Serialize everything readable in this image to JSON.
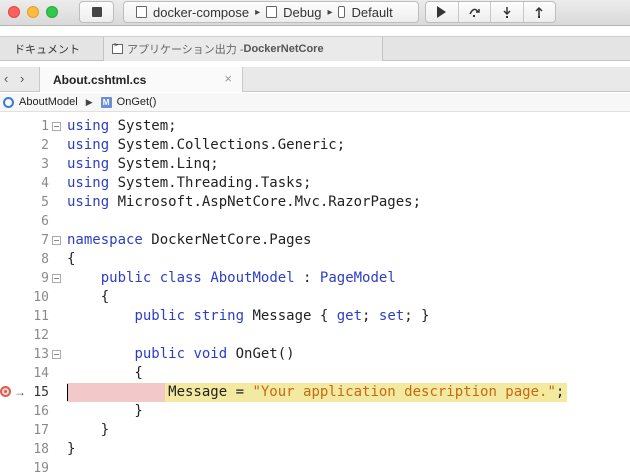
{
  "toolbar": {
    "project": "docker-compose",
    "configuration": "Debug",
    "device": "Default"
  },
  "pad_tabs": {
    "documents": "ドキュメント",
    "output_prefix": "アプリケーション出力 - ",
    "output_name": "DockerNetCore"
  },
  "editor": {
    "tab_title": "About.cshtml.cs",
    "close_symbol": "×",
    "nav_arrows": "‹ ›"
  },
  "pathbar": {
    "class_name": "AboutModel",
    "method_name": "OnGet()",
    "method_icon_letter": "M"
  },
  "code": {
    "breakpoint_line": 15,
    "lines": [
      {
        "n": "1",
        "fold": true,
        "t": [
          [
            "kw",
            "using"
          ],
          [
            "plain",
            " System;"
          ]
        ]
      },
      {
        "n": "2",
        "t": [
          [
            "kw",
            "using"
          ],
          [
            "plain",
            " System.Collections.Generic;"
          ]
        ]
      },
      {
        "n": "3",
        "t": [
          [
            "kw",
            "using"
          ],
          [
            "plain",
            " System.Linq;"
          ]
        ]
      },
      {
        "n": "4",
        "t": [
          [
            "kw",
            "using"
          ],
          [
            "plain",
            " System.Threading.Tasks;"
          ]
        ]
      },
      {
        "n": "5",
        "t": [
          [
            "kw",
            "using"
          ],
          [
            "plain",
            " Microsoft.AspNetCore.Mvc.RazorPages;"
          ]
        ]
      },
      {
        "n": "6",
        "t": []
      },
      {
        "n": "7",
        "fold": true,
        "t": [
          [
            "kw",
            "namespace"
          ],
          [
            "plain",
            " DockerNetCore.Pages"
          ]
        ]
      },
      {
        "n": "8",
        "t": [
          [
            "plain",
            "{"
          ]
        ]
      },
      {
        "n": "9",
        "fold": true,
        "t": [
          [
            "plain",
            "    "
          ],
          [
            "kw",
            "public class"
          ],
          [
            "plain",
            " "
          ],
          [
            "ty",
            "AboutModel"
          ],
          [
            "plain",
            " : "
          ],
          [
            "ty",
            "PageModel"
          ]
        ]
      },
      {
        "n": "10",
        "t": [
          [
            "plain",
            "    {"
          ]
        ]
      },
      {
        "n": "11",
        "t": [
          [
            "plain",
            "        "
          ],
          [
            "kw",
            "public string"
          ],
          [
            "plain",
            " Message { "
          ],
          [
            "kw",
            "get"
          ],
          [
            "plain",
            "; "
          ],
          [
            "kw",
            "set"
          ],
          [
            "plain",
            "; }"
          ]
        ]
      },
      {
        "n": "12",
        "t": []
      },
      {
        "n": "13",
        "fold": true,
        "t": [
          [
            "plain",
            "        "
          ],
          [
            "kw",
            "public void"
          ],
          [
            "plain",
            " OnGet()"
          ]
        ]
      },
      {
        "n": "14",
        "t": [
          [
            "plain",
            "        {"
          ]
        ]
      },
      {
        "n": "15",
        "t": [
          [
            "plain",
            "            Message = "
          ],
          [
            "str",
            "\"Your application description page.\""
          ],
          [
            "plain",
            ";"
          ]
        ]
      },
      {
        "n": "16",
        "t": [
          [
            "plain",
            "        }"
          ]
        ]
      },
      {
        "n": "17",
        "t": [
          [
            "plain",
            "    }"
          ]
        ]
      },
      {
        "n": "18",
        "t": [
          [
            "plain",
            "}"
          ]
        ]
      },
      {
        "n": "19",
        "t": []
      }
    ]
  },
  "colors": {
    "keyword": "#2c3ec6",
    "string": "#c26a16",
    "breakpoint_highlight": "#f4e9a1",
    "breakpoint_marker": "#e05b4f"
  }
}
